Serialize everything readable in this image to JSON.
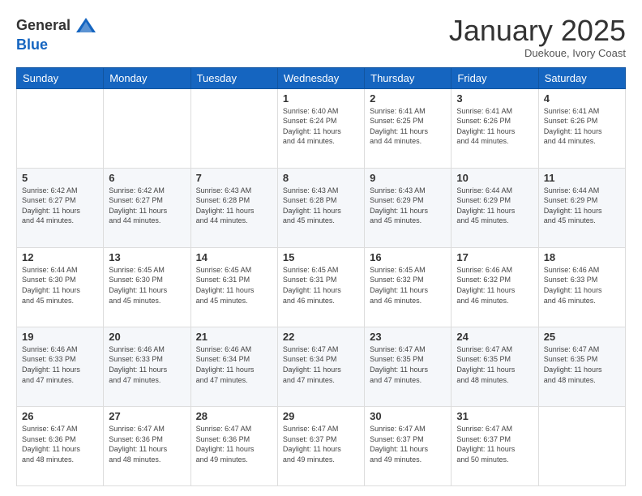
{
  "header": {
    "logo_line1": "General",
    "logo_line2": "Blue",
    "month": "January 2025",
    "location": "Duekoue, Ivory Coast"
  },
  "weekdays": [
    "Sunday",
    "Monday",
    "Tuesday",
    "Wednesday",
    "Thursday",
    "Friday",
    "Saturday"
  ],
  "weeks": [
    [
      {
        "day": "",
        "info": ""
      },
      {
        "day": "",
        "info": ""
      },
      {
        "day": "",
        "info": ""
      },
      {
        "day": "1",
        "info": "Sunrise: 6:40 AM\nSunset: 6:24 PM\nDaylight: 11 hours\nand 44 minutes."
      },
      {
        "day": "2",
        "info": "Sunrise: 6:41 AM\nSunset: 6:25 PM\nDaylight: 11 hours\nand 44 minutes."
      },
      {
        "day": "3",
        "info": "Sunrise: 6:41 AM\nSunset: 6:26 PM\nDaylight: 11 hours\nand 44 minutes."
      },
      {
        "day": "4",
        "info": "Sunrise: 6:41 AM\nSunset: 6:26 PM\nDaylight: 11 hours\nand 44 minutes."
      }
    ],
    [
      {
        "day": "5",
        "info": "Sunrise: 6:42 AM\nSunset: 6:27 PM\nDaylight: 11 hours\nand 44 minutes."
      },
      {
        "day": "6",
        "info": "Sunrise: 6:42 AM\nSunset: 6:27 PM\nDaylight: 11 hours\nand 44 minutes."
      },
      {
        "day": "7",
        "info": "Sunrise: 6:43 AM\nSunset: 6:28 PM\nDaylight: 11 hours\nand 44 minutes."
      },
      {
        "day": "8",
        "info": "Sunrise: 6:43 AM\nSunset: 6:28 PM\nDaylight: 11 hours\nand 45 minutes."
      },
      {
        "day": "9",
        "info": "Sunrise: 6:43 AM\nSunset: 6:29 PM\nDaylight: 11 hours\nand 45 minutes."
      },
      {
        "day": "10",
        "info": "Sunrise: 6:44 AM\nSunset: 6:29 PM\nDaylight: 11 hours\nand 45 minutes."
      },
      {
        "day": "11",
        "info": "Sunrise: 6:44 AM\nSunset: 6:29 PM\nDaylight: 11 hours\nand 45 minutes."
      }
    ],
    [
      {
        "day": "12",
        "info": "Sunrise: 6:44 AM\nSunset: 6:30 PM\nDaylight: 11 hours\nand 45 minutes."
      },
      {
        "day": "13",
        "info": "Sunrise: 6:45 AM\nSunset: 6:30 PM\nDaylight: 11 hours\nand 45 minutes."
      },
      {
        "day": "14",
        "info": "Sunrise: 6:45 AM\nSunset: 6:31 PM\nDaylight: 11 hours\nand 45 minutes."
      },
      {
        "day": "15",
        "info": "Sunrise: 6:45 AM\nSunset: 6:31 PM\nDaylight: 11 hours\nand 46 minutes."
      },
      {
        "day": "16",
        "info": "Sunrise: 6:45 AM\nSunset: 6:32 PM\nDaylight: 11 hours\nand 46 minutes."
      },
      {
        "day": "17",
        "info": "Sunrise: 6:46 AM\nSunset: 6:32 PM\nDaylight: 11 hours\nand 46 minutes."
      },
      {
        "day": "18",
        "info": "Sunrise: 6:46 AM\nSunset: 6:33 PM\nDaylight: 11 hours\nand 46 minutes."
      }
    ],
    [
      {
        "day": "19",
        "info": "Sunrise: 6:46 AM\nSunset: 6:33 PM\nDaylight: 11 hours\nand 47 minutes."
      },
      {
        "day": "20",
        "info": "Sunrise: 6:46 AM\nSunset: 6:33 PM\nDaylight: 11 hours\nand 47 minutes."
      },
      {
        "day": "21",
        "info": "Sunrise: 6:46 AM\nSunset: 6:34 PM\nDaylight: 11 hours\nand 47 minutes."
      },
      {
        "day": "22",
        "info": "Sunrise: 6:47 AM\nSunset: 6:34 PM\nDaylight: 11 hours\nand 47 minutes."
      },
      {
        "day": "23",
        "info": "Sunrise: 6:47 AM\nSunset: 6:35 PM\nDaylight: 11 hours\nand 47 minutes."
      },
      {
        "day": "24",
        "info": "Sunrise: 6:47 AM\nSunset: 6:35 PM\nDaylight: 11 hours\nand 48 minutes."
      },
      {
        "day": "25",
        "info": "Sunrise: 6:47 AM\nSunset: 6:35 PM\nDaylight: 11 hours\nand 48 minutes."
      }
    ],
    [
      {
        "day": "26",
        "info": "Sunrise: 6:47 AM\nSunset: 6:36 PM\nDaylight: 11 hours\nand 48 minutes."
      },
      {
        "day": "27",
        "info": "Sunrise: 6:47 AM\nSunset: 6:36 PM\nDaylight: 11 hours\nand 48 minutes."
      },
      {
        "day": "28",
        "info": "Sunrise: 6:47 AM\nSunset: 6:36 PM\nDaylight: 11 hours\nand 49 minutes."
      },
      {
        "day": "29",
        "info": "Sunrise: 6:47 AM\nSunset: 6:37 PM\nDaylight: 11 hours\nand 49 minutes."
      },
      {
        "day": "30",
        "info": "Sunrise: 6:47 AM\nSunset: 6:37 PM\nDaylight: 11 hours\nand 49 minutes."
      },
      {
        "day": "31",
        "info": "Sunrise: 6:47 AM\nSunset: 6:37 PM\nDaylight: 11 hours\nand 50 minutes."
      },
      {
        "day": "",
        "info": ""
      }
    ]
  ]
}
